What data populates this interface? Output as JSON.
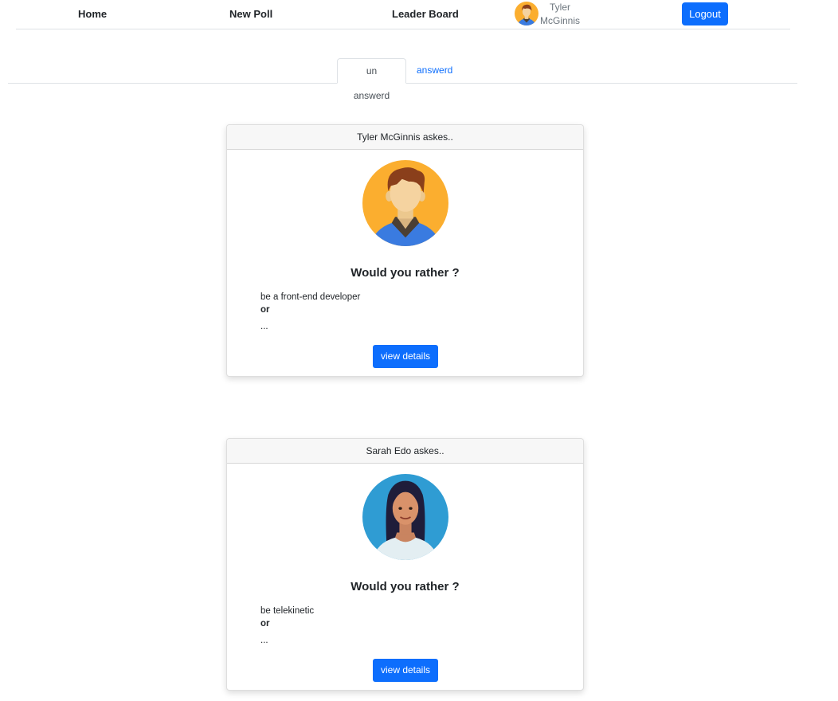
{
  "nav": {
    "home": "Home",
    "new_poll": "New Poll",
    "leader_board": "Leader Board",
    "user_name": "Tyler McGinnis",
    "logout": "Logout"
  },
  "tabs": [
    {
      "label": "un answerd",
      "active": true
    },
    {
      "label": "answerd",
      "active": false
    }
  ],
  "questions": [
    {
      "author_line": "Tyler McGinnis askes..",
      "avatar": "male-avatar-icon",
      "title": "Would you rather ?",
      "option_one": "be a front-end developer",
      "or_label": "or",
      "ellipsis": "...",
      "button": "view details"
    },
    {
      "author_line": "Sarah Edo askes..",
      "avatar": "female-avatar-icon",
      "title": "Would you rather ?",
      "option_one": "be telekinetic",
      "or_label": "or",
      "ellipsis": "...",
      "button": "view details"
    }
  ],
  "colors": {
    "primary": "#0d6efd",
    "male_avatar_bg": "#fbae2f",
    "female_avatar_bg": "#2f9cd3"
  }
}
